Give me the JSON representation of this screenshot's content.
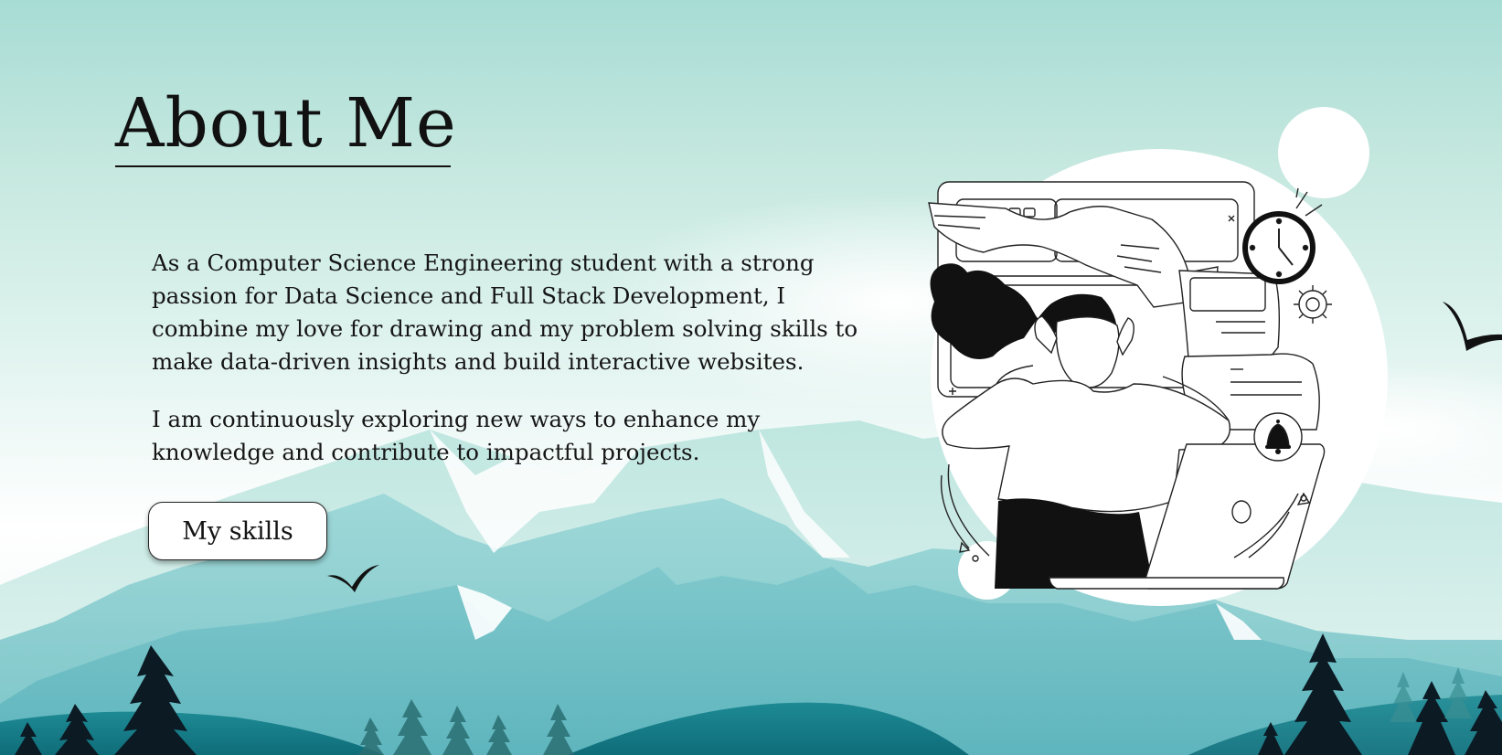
{
  "section": {
    "title": "About Me",
    "paragraphs": [
      "As a Computer Science Engineering student with a strong passion for Data Science and Full Stack Development, I combine my love for drawing and my problem solving skills to make data-driven insights and build interactive websites.",
      "I am continuously exploring new ways to enhance my knowledge and contribute to impactful projects."
    ],
    "button_label": "My skills"
  },
  "illustration": {
    "subject": "stressed-developer-with-laptop",
    "icons": [
      "clock-icon",
      "gear-icon",
      "bell-icon"
    ]
  },
  "colors": {
    "sky_top": "#a7dcd5",
    "mountain_light": "#8fd0d3",
    "mountain_mid": "#6fbfc4",
    "hill_dark": "#167f8a",
    "tree": "#0c1a24",
    "text": "#141414"
  }
}
